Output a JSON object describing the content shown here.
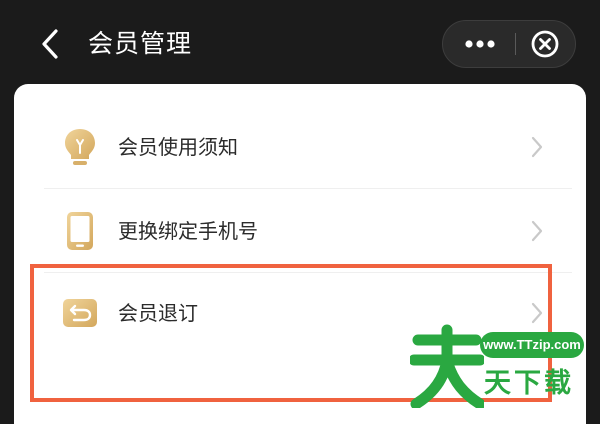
{
  "header": {
    "title": "会员管理",
    "back_icon": "chevron-left-icon",
    "more_icon": "more-dots-icon",
    "close_icon": "close-circle-icon"
  },
  "menu": {
    "items": [
      {
        "label": "会员使用须知",
        "icon": "lightbulb-icon"
      },
      {
        "label": "更换绑定手机号",
        "icon": "phone-icon"
      },
      {
        "label": "会员退订",
        "icon": "unsubscribe-return-icon"
      }
    ]
  },
  "watermark": {
    "url": "www.TTzip.com",
    "name": "天下载"
  },
  "colors": {
    "header_bg": "#1b1b1b",
    "card_bg": "#ffffff",
    "icon_gold": "#e2bf7e",
    "highlight": "#f0623f",
    "watermark_green": "#2aa841"
  }
}
